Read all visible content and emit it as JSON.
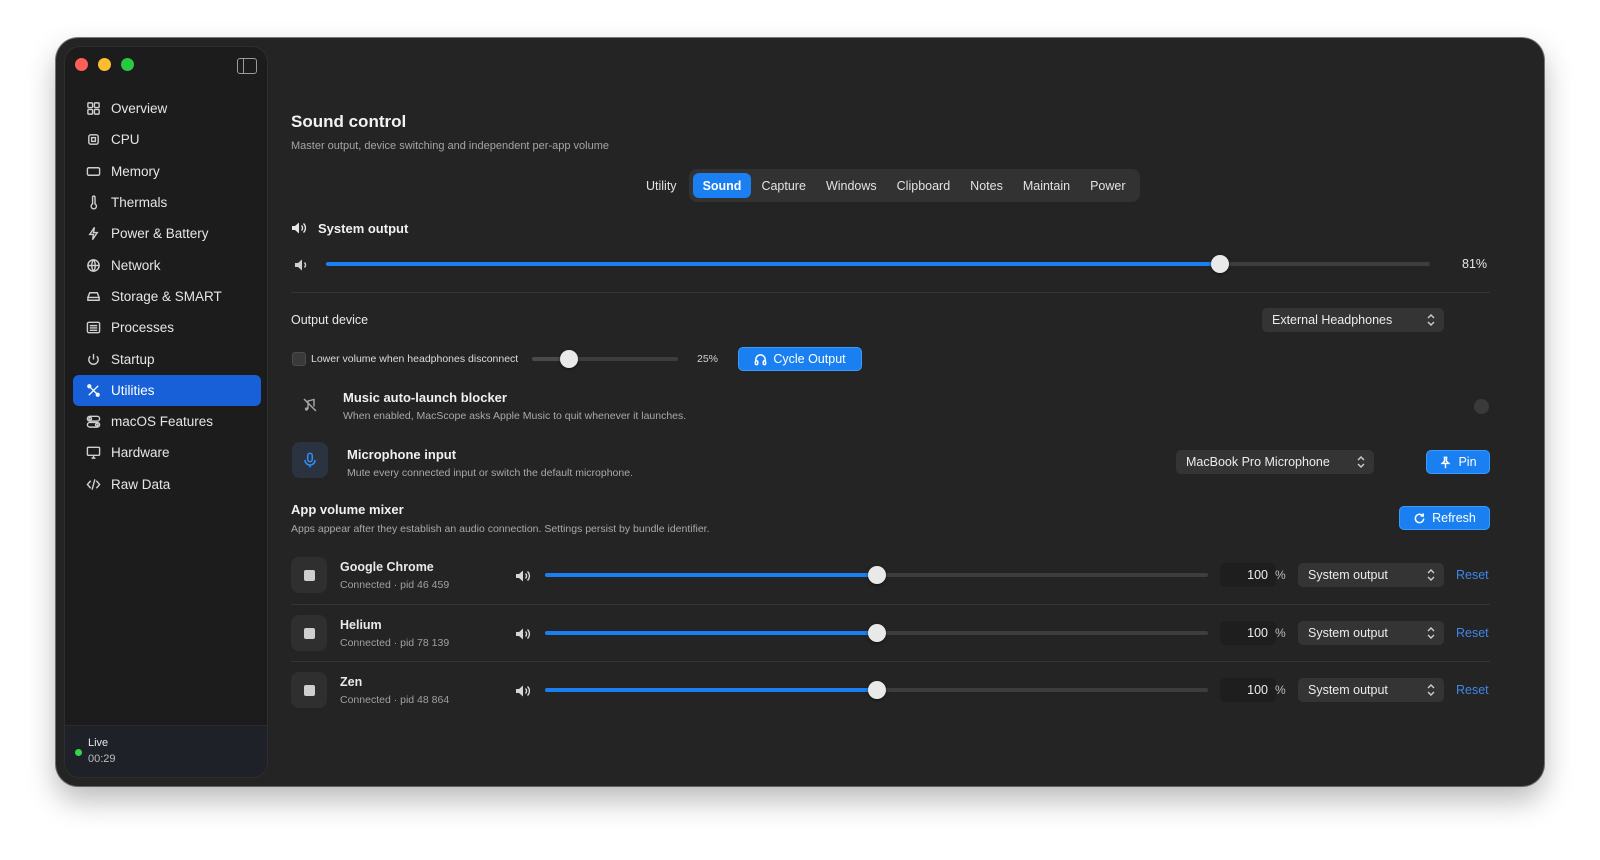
{
  "sidebar": {
    "items": [
      {
        "label": "Overview",
        "icon": "grid-icon"
      },
      {
        "label": "CPU",
        "icon": "cpu-icon"
      },
      {
        "label": "Memory",
        "icon": "memory-icon"
      },
      {
        "label": "Thermals",
        "icon": "thermometer-icon"
      },
      {
        "label": "Power & Battery",
        "icon": "bolt-icon"
      },
      {
        "label": "Network",
        "icon": "globe-icon"
      },
      {
        "label": "Storage & SMART",
        "icon": "drive-icon"
      },
      {
        "label": "Processes",
        "icon": "list-icon"
      },
      {
        "label": "Startup",
        "icon": "power-icon"
      },
      {
        "label": "Utilities",
        "icon": "tools-icon",
        "active": true
      },
      {
        "label": "macOS Features",
        "icon": "toggles-icon"
      },
      {
        "label": "Hardware",
        "icon": "monitor-icon"
      },
      {
        "label": "Raw Data",
        "icon": "code-icon"
      }
    ],
    "status": {
      "label": "Live",
      "time": "00:29",
      "color": "#32d74b"
    }
  },
  "page": {
    "title": "Sound control",
    "subtitle": "Master output, device switching and independent per-app volume"
  },
  "tabs": {
    "plain": "Utility",
    "items": [
      "Sound",
      "Capture",
      "Windows",
      "Clipboard",
      "Notes",
      "Maintain",
      "Power"
    ],
    "active": "Sound"
  },
  "system_output": {
    "title": "System output",
    "volume_percent": 81,
    "value_label": "81%"
  },
  "output_device": {
    "title": "Output device",
    "selected": "External Headphones",
    "lower_volume_label": "Lower volume when headphones disconnect",
    "lower_volume_checked": false,
    "lower_volume_percent": 25,
    "lower_volume_value_label": "25%",
    "cycle_button": "Cycle Output"
  },
  "music_blocker": {
    "title": "Music auto-launch blocker",
    "description": "When enabled, MacScope asks Apple Music to quit whenever it launches.",
    "enabled": false
  },
  "microphone": {
    "title": "Microphone input",
    "description": "Mute every connected input or switch the default microphone.",
    "selected": "MacBook Pro Microphone",
    "pin_button": "Pin"
  },
  "mixer": {
    "title": "App volume mixer",
    "description": "Apps appear after they establish an audio connection. Settings persist by bundle identifier.",
    "refresh_button": "Refresh",
    "percent_symbol": "%",
    "reset_label": "Reset",
    "apps": [
      {
        "name": "Google Chrome",
        "status": "Connected · pid 46 459",
        "volume": 100,
        "volume_label": "100",
        "output": "System output"
      },
      {
        "name": "Helium",
        "status": "Connected · pid 78 139",
        "volume": 100,
        "volume_label": "100",
        "output": "System output"
      },
      {
        "name": "Zen",
        "status": "Connected · pid 48 864",
        "volume": 100,
        "volume_label": "100",
        "output": "System output"
      }
    ]
  },
  "colors": {
    "accent": "#1a7ff0",
    "sidebar_active": "#1760d8",
    "reset_link": "#3f86e8"
  }
}
